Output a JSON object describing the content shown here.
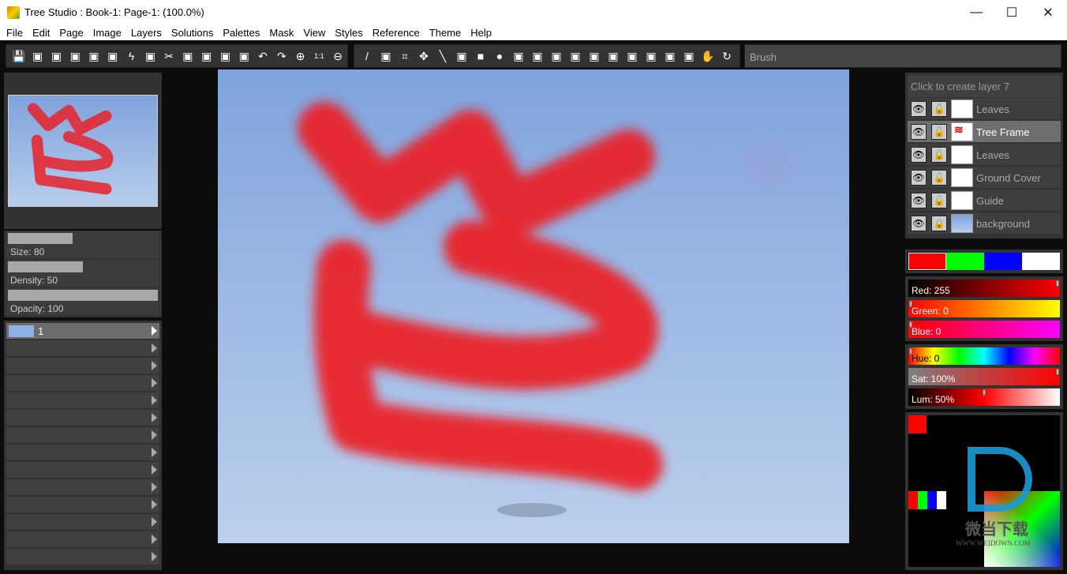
{
  "window": {
    "title": "Tree Studio : Book-1: Page-1:  (100.0%)",
    "minimize": "—",
    "maximize": "☐",
    "close": "✕"
  },
  "menu": [
    "File",
    "Edit",
    "Page",
    "Image",
    "Layers",
    "Solutions",
    "Palettes",
    "Mask",
    "View",
    "Styles",
    "Reference",
    "Theme",
    "Help"
  ],
  "toolbar": {
    "group1": [
      "save-icon",
      "save-all-icon",
      "page-prev-icon",
      "page-back-icon",
      "page-forward-icon",
      "page-next-icon",
      "lightning-icon",
      "list-icon",
      "cut-icon",
      "copy-icon",
      "paste-icon",
      "erase-paste-icon",
      "fill-paste-icon",
      "undo-icon",
      "redo-icon",
      "zoom-in-icon",
      "actual-size-icon",
      "zoom-out-icon"
    ],
    "group2": [
      "brush-icon",
      "eyedropper-icon",
      "crop-icon",
      "move-icon",
      "line-icon",
      "lasso-icon",
      "rectangle-icon",
      "ellipse-icon",
      "fill-icon",
      "checker-icon",
      "checker2-icon",
      "checker3-icon",
      "dither-icon",
      "sparkle-icon",
      "wand-icon",
      "spray-icon",
      "grid-icon",
      "stamp-icon",
      "hand-icon",
      "rotate-icon"
    ],
    "tool_name": "Brush"
  },
  "brush": {
    "size_label": "Size: 80",
    "size": 80,
    "density_label": "Density: 50",
    "density": 50,
    "opacity_label": "Opacity: 100",
    "opacity": 100
  },
  "pages": [
    {
      "label": "1",
      "selected": true
    }
  ],
  "layers": {
    "create_label": "Click to create layer 7",
    "items": [
      {
        "name": "Leaves",
        "selected": false
      },
      {
        "name": "Tree Frame",
        "selected": true
      },
      {
        "name": "Leaves",
        "selected": false
      },
      {
        "name": "Ground Cover",
        "selected": false
      },
      {
        "name": "Guide",
        "selected": false
      },
      {
        "name": "background",
        "selected": false
      }
    ]
  },
  "swatches": [
    "#ff0000",
    "#00ff00",
    "#0000ff",
    "#ffffff"
  ],
  "color": {
    "red_label": "Red: 255",
    "red": 255,
    "green_label": "Green: 0",
    "green": 0,
    "blue_label": "Blue: 0",
    "blue": 0,
    "hue_label": "Hue: 0",
    "hue": 0,
    "sat_label": "Sat: 100%",
    "sat": 100,
    "lum_label": "Lum: 50%",
    "lum": 50
  },
  "watermark": {
    "text": "微当下载",
    "url": "WWW.WEIDOWN.COM"
  }
}
